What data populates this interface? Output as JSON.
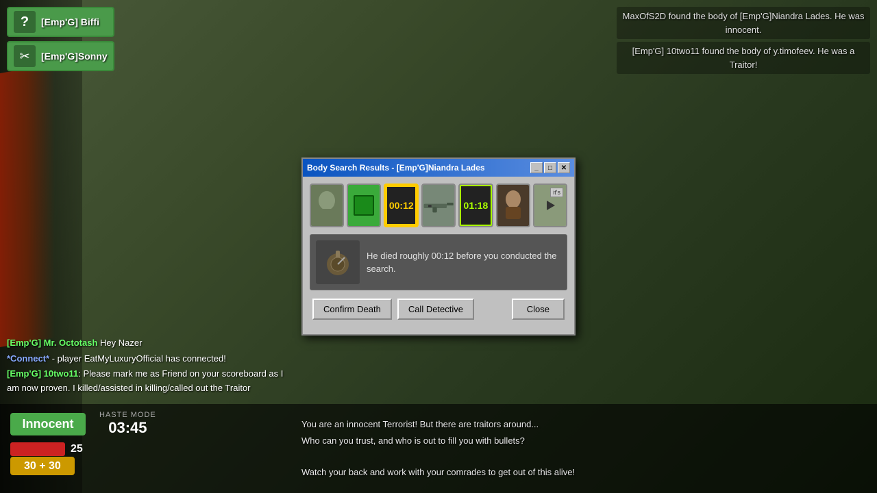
{
  "game": {
    "bg_color": "#3a4a30"
  },
  "notifications": [
    {
      "text": "MaxOfS2D found the body of [Emp'G]Niandra Lades. He was innocent."
    },
    {
      "text": "[Emp'G] 10two11 found the body of y.timofeev. He was a Traitor!"
    }
  ],
  "players": [
    {
      "name": "[Emp'G] Biffi",
      "icon": "?"
    },
    {
      "name": "[Emp'G]Sonny",
      "icon": "✂"
    }
  ],
  "chat": [
    {
      "player": "[Emp'G] Mr. Octotash",
      "message": " Hey Nazer",
      "type": "player"
    },
    {
      "prefix": "*Connect*",
      "message": " - player EatMyLuxuryOfficial has connected!",
      "type": "connect"
    },
    {
      "player": "[Emp'G] 10two11",
      "message": ": Please mark me as Friend on your scoreboard as I am now proven. I killed/assisted in killing/called out the Traitor",
      "type": "player"
    }
  ],
  "hud": {
    "role": "Innocent",
    "haste_label": "HASTE MODE",
    "timer": "03:45",
    "health": 25,
    "ammo": "30 + 30"
  },
  "bottom_message": {
    "line1": "You are an innocent Terrorist! But there are traitors around...",
    "line2": "Who can you trust, and who is out to fill you with bullets?",
    "line3": "",
    "line4": "Watch your back and work with your comrades to get out of this alive!"
  },
  "modal": {
    "title": "Body Search Results - [Emp'G]Niandra Lades",
    "minimize_label": "_",
    "restore_label": "□",
    "close_label": "✕",
    "death_description": "He died roughly 00:12 before you conducted the search.",
    "evidence_cards": [
      {
        "type": "face",
        "label": "player_face"
      },
      {
        "type": "team",
        "label": "team_indicator"
      },
      {
        "type": "time",
        "value": "00:12",
        "label": "time_of_death",
        "selected": true
      },
      {
        "type": "weapon",
        "label": "weapon"
      },
      {
        "type": "lastseen",
        "value": "01:18",
        "label": "last_seen"
      },
      {
        "type": "suspect",
        "label": "suspect"
      },
      {
        "type": "video",
        "label": "its_video"
      }
    ],
    "buttons": {
      "confirm_death": "Confirm Death",
      "call_detective": "Call Detective",
      "close": "Close"
    }
  }
}
